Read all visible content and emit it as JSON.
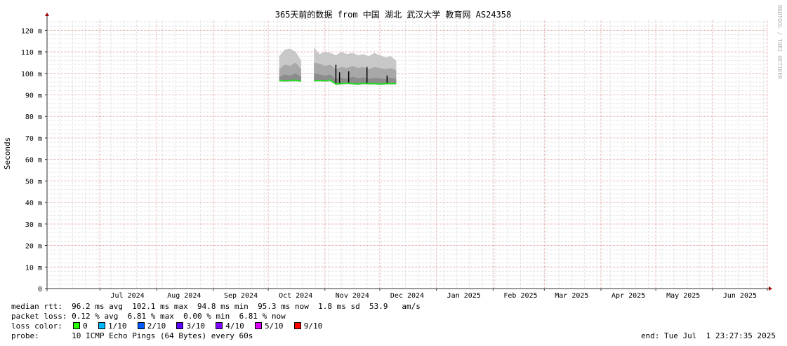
{
  "chart_data": {
    "type": "area",
    "title": "365天前的数据 from 中国 湖北 武汉大学 教育网 AS24358",
    "ylabel": "Seconds",
    "watermark": "RRDTOOL / TOBI OETIKER",
    "ylim": [
      0,
      0.125
    ],
    "y_ticks": [
      {
        "value": 0,
        "label": "0"
      },
      {
        "value": 0.01,
        "label": "10 m"
      },
      {
        "value": 0.02,
        "label": "20 m"
      },
      {
        "value": 0.03,
        "label": "30 m"
      },
      {
        "value": 0.04,
        "label": "40 m"
      },
      {
        "value": 0.05,
        "label": "50 m"
      },
      {
        "value": 0.06,
        "label": "60 m"
      },
      {
        "value": 0.07,
        "label": "70 m"
      },
      {
        "value": 0.08,
        "label": "80 m"
      },
      {
        "value": 0.09,
        "label": "90 m"
      },
      {
        "value": 0.1,
        "label": "100 m"
      },
      {
        "value": 0.11,
        "label": "110 m"
      },
      {
        "value": 0.12,
        "label": "120 m"
      }
    ],
    "x_range": [
      "2024-06-02",
      "2025-07-01"
    ],
    "x_ticks": [
      {
        "date": "2024-07-16",
        "label": "Jul 2024"
      },
      {
        "date": "2024-08-16",
        "label": "Aug 2024"
      },
      {
        "date": "2024-09-16",
        "label": "Sep 2024"
      },
      {
        "date": "2024-10-16",
        "label": "Oct 2024"
      },
      {
        "date": "2024-11-16",
        "label": "Nov 2024"
      },
      {
        "date": "2024-12-16",
        "label": "Dec 2024"
      },
      {
        "date": "2025-01-16",
        "label": "Jan 2025"
      },
      {
        "date": "2025-02-16",
        "label": "Feb 2025"
      },
      {
        "date": "2025-03-16",
        "label": "Mar 2025"
      },
      {
        "date": "2025-04-16",
        "label": "Apr 2025"
      },
      {
        "date": "2025-05-16",
        "label": "May 2025"
      },
      {
        "date": "2025-06-16",
        "label": "Jun 2025"
      }
    ],
    "month_starts": [
      "2024-07-01",
      "2024-08-01",
      "2024-09-01",
      "2024-10-01",
      "2024-11-01",
      "2024-12-01",
      "2025-01-01",
      "2025-02-01",
      "2025-03-01",
      "2025-04-01",
      "2025-05-01",
      "2025-06-01",
      "2025-07-01"
    ],
    "series": [
      {
        "name": "median rtt",
        "x": [
          "2024-10-07",
          "2024-10-10",
          "2024-10-13",
          "2024-10-16",
          "2024-10-19",
          "2024-10-22",
          "2024-10-26",
          "2024-10-29",
          "2024-11-01",
          "2024-11-04",
          "2024-11-07",
          "2024-11-10",
          "2024-11-13",
          "2024-11-16",
          "2024-11-19",
          "2024-11-22",
          "2024-11-25",
          "2024-11-28",
          "2024-12-01",
          "2024-12-04",
          "2024-12-07",
          "2024-12-10"
        ],
        "values": [
          0.0968,
          0.0966,
          0.0967,
          0.0968,
          0.0965,
          0.0965,
          0.0966,
          0.0967,
          0.0966,
          0.0969,
          0.0951,
          0.0953,
          0.0955,
          0.0953,
          0.0951,
          0.0954,
          0.0952,
          0.0953,
          0.0951,
          0.0952,
          0.0953,
          0.0953
        ],
        "min": [
          0.0962,
          0.096,
          0.0961,
          0.0962,
          0.096,
          0.096,
          0.0961,
          0.0962,
          0.096,
          0.0961,
          0.0946,
          0.0948,
          0.0949,
          0.0948,
          0.0947,
          0.0948,
          0.0948,
          0.0948,
          0.0947,
          0.0948,
          0.0948,
          0.0948
        ],
        "max": [
          0.108,
          0.111,
          0.1115,
          0.11,
          0.106,
          0.1105,
          0.112,
          0.109,
          0.11,
          0.1095,
          0.1085,
          0.11,
          0.109,
          0.1095,
          0.1085,
          0.109,
          0.108,
          0.1095,
          0.1085,
          0.1075,
          0.108,
          0.106
        ],
        "p25": [
          0.0985,
          0.0995,
          0.099,
          0.1,
          0.0985,
          0.099,
          0.1,
          0.0995,
          0.099,
          0.0995,
          0.0975,
          0.098,
          0.0975,
          0.0985,
          0.0978,
          0.0982,
          0.0975,
          0.098,
          0.0978,
          0.0975,
          0.098,
          0.0975
        ],
        "p75": [
          0.102,
          0.104,
          0.1035,
          0.105,
          0.102,
          0.104,
          0.105,
          0.1045,
          0.1035,
          0.104,
          0.102,
          0.103,
          0.1025,
          0.1035,
          0.1025,
          0.103,
          0.102,
          0.103,
          0.1025,
          0.102,
          0.1025,
          0.1015
        ]
      }
    ],
    "gaps": [
      [
        "2024-10-20",
        "2024-10-22"
      ]
    ],
    "spikes": [
      {
        "date": "2024-11-07",
        "value": 0.104
      },
      {
        "date": "2024-11-09",
        "value": 0.1005
      },
      {
        "date": "2024-11-14",
        "value": 0.101
      },
      {
        "date": "2024-11-24",
        "value": 0.103
      },
      {
        "date": "2024-12-05",
        "value": 0.099
      }
    ],
    "grid": true,
    "colors": {
      "minor_grid": "#dddddd",
      "major_grid": "#e6a8a8",
      "axis": "#333333",
      "arrow": "#a00000",
      "band_outer": "#c8c8c8",
      "band_mid": "#a8a8a8",
      "band_inner": "#8c8c8c",
      "median_line": "#22dd22"
    }
  },
  "legend": {
    "median": {
      "label": "median rtt:",
      "avg": "96.2 ms avg",
      "max": "102.1 ms max",
      "min": "94.8 ms min",
      "now": "95.3 ms now",
      "sd": "1.8 ms sd",
      "amps": "53.9   am/s"
    },
    "loss": {
      "label": "packet loss:",
      "avg": "0.12 % avg",
      "max": "6.81 % max",
      "min": "0.00 % min",
      "now": "6.81 % now"
    },
    "loss_color": {
      "label": "loss color:",
      "items": [
        {
          "label": "0",
          "color": "#26ff00"
        },
        {
          "label": "1/10",
          "color": "#00b8ff"
        },
        {
          "label": "2/10",
          "color": "#0059ff"
        },
        {
          "label": "3/10",
          "color": "#5e00ff"
        },
        {
          "label": "4/10",
          "color": "#7e00ff"
        },
        {
          "label": "5/10",
          "color": "#dd00ff"
        },
        {
          "label": "9/10",
          "color": "#ff0000"
        }
      ]
    },
    "probe": {
      "label": "probe:",
      "value": "10 ICMP Echo Pings (64 Bytes) every 60s"
    },
    "end": "end: Tue Jul  1 23:27:35 2025"
  }
}
